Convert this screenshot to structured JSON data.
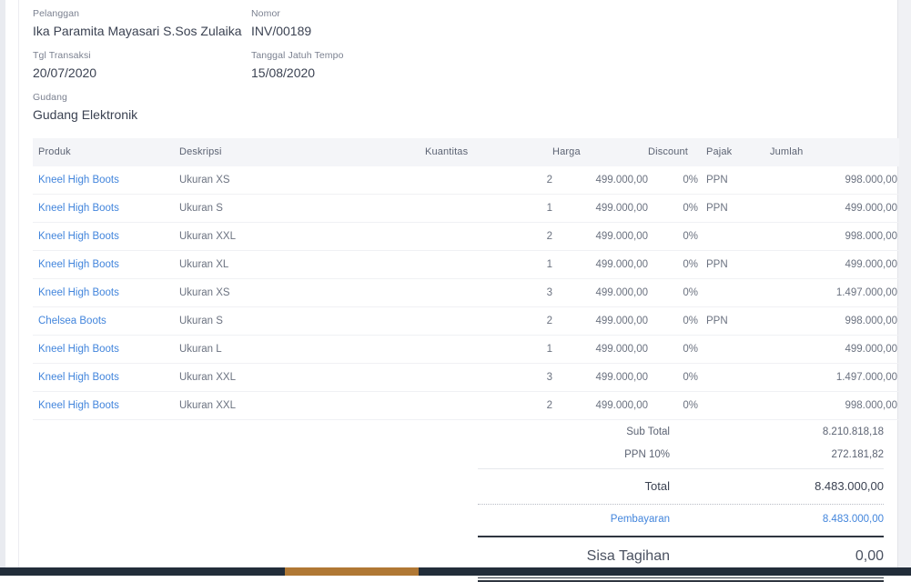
{
  "header": {
    "fields": [
      {
        "label": "Pelanggan",
        "value": "Ika Paramita Mayasari S.Sos Zulaika"
      },
      {
        "label": "Nomor",
        "value": "INV/00189"
      },
      {
        "label": "Tgl Transaksi",
        "value": "20/07/2020"
      },
      {
        "label": "Tanggal Jatuh Tempo",
        "value": "15/08/2020"
      },
      {
        "label": "Gudang",
        "value": "Gudang Elektronik"
      }
    ]
  },
  "table": {
    "columns": {
      "produk": "Produk",
      "deskripsi": "Deskripsi",
      "kuantitas": "Kuantitas",
      "harga": "Harga",
      "discount": "Discount",
      "pajak": "Pajak",
      "jumlah": "Jumlah"
    },
    "rows": [
      {
        "produk": "Kneel High Boots",
        "deskripsi": "Ukuran XS",
        "kuantitas": "2",
        "harga": "499.000,00",
        "discount": "0%",
        "pajak": "PPN",
        "jumlah": "998.000,00"
      },
      {
        "produk": "Kneel High Boots",
        "deskripsi": "Ukuran S",
        "kuantitas": "1",
        "harga": "499.000,00",
        "discount": "0%",
        "pajak": "PPN",
        "jumlah": "499.000,00"
      },
      {
        "produk": "Kneel High Boots",
        "deskripsi": "Ukuran XXL",
        "kuantitas": "2",
        "harga": "499.000,00",
        "discount": "0%",
        "pajak": "",
        "jumlah": "998.000,00"
      },
      {
        "produk": "Kneel High Boots",
        "deskripsi": "Ukuran XL",
        "kuantitas": "1",
        "harga": "499.000,00",
        "discount": "0%",
        "pajak": "PPN",
        "jumlah": "499.000,00"
      },
      {
        "produk": "Kneel High Boots",
        "deskripsi": "Ukuran XS",
        "kuantitas": "3",
        "harga": "499.000,00",
        "discount": "0%",
        "pajak": "",
        "jumlah": "1.497.000,00"
      },
      {
        "produk": "Chelsea Boots",
        "deskripsi": "Ukuran S",
        "kuantitas": "2",
        "harga": "499.000,00",
        "discount": "0%",
        "pajak": "PPN",
        "jumlah": "998.000,00"
      },
      {
        "produk": "Kneel High Boots",
        "deskripsi": "Ukuran L",
        "kuantitas": "1",
        "harga": "499.000,00",
        "discount": "0%",
        "pajak": "",
        "jumlah": "499.000,00"
      },
      {
        "produk": "Kneel High Boots",
        "deskripsi": "Ukuran XXL",
        "kuantitas": "3",
        "harga": "499.000,00",
        "discount": "0%",
        "pajak": "",
        "jumlah": "1.497.000,00"
      },
      {
        "produk": "Kneel High Boots",
        "deskripsi": "Ukuran XXL",
        "kuantitas": "2",
        "harga": "499.000,00",
        "discount": "0%",
        "pajak": "",
        "jumlah": "998.000,00"
      }
    ]
  },
  "totals": {
    "subtotal_label": "Sub Total",
    "subtotal_value": "8.210.818,18",
    "ppn_label": "PPN 10%",
    "ppn_value": "272.181,82",
    "total_label": "Total",
    "total_value": "8.483.000,00",
    "payment_label": "Pembayaran",
    "payment_value": "8.483.000,00",
    "due_label": "Sisa Tagihan",
    "due_value": "0,00"
  },
  "colors": {
    "link": "#4285dc",
    "header_band": "#f4f5f8",
    "text": "#5c6373",
    "footer_bar": "#222d3a",
    "footer_accent": "#b07834"
  }
}
